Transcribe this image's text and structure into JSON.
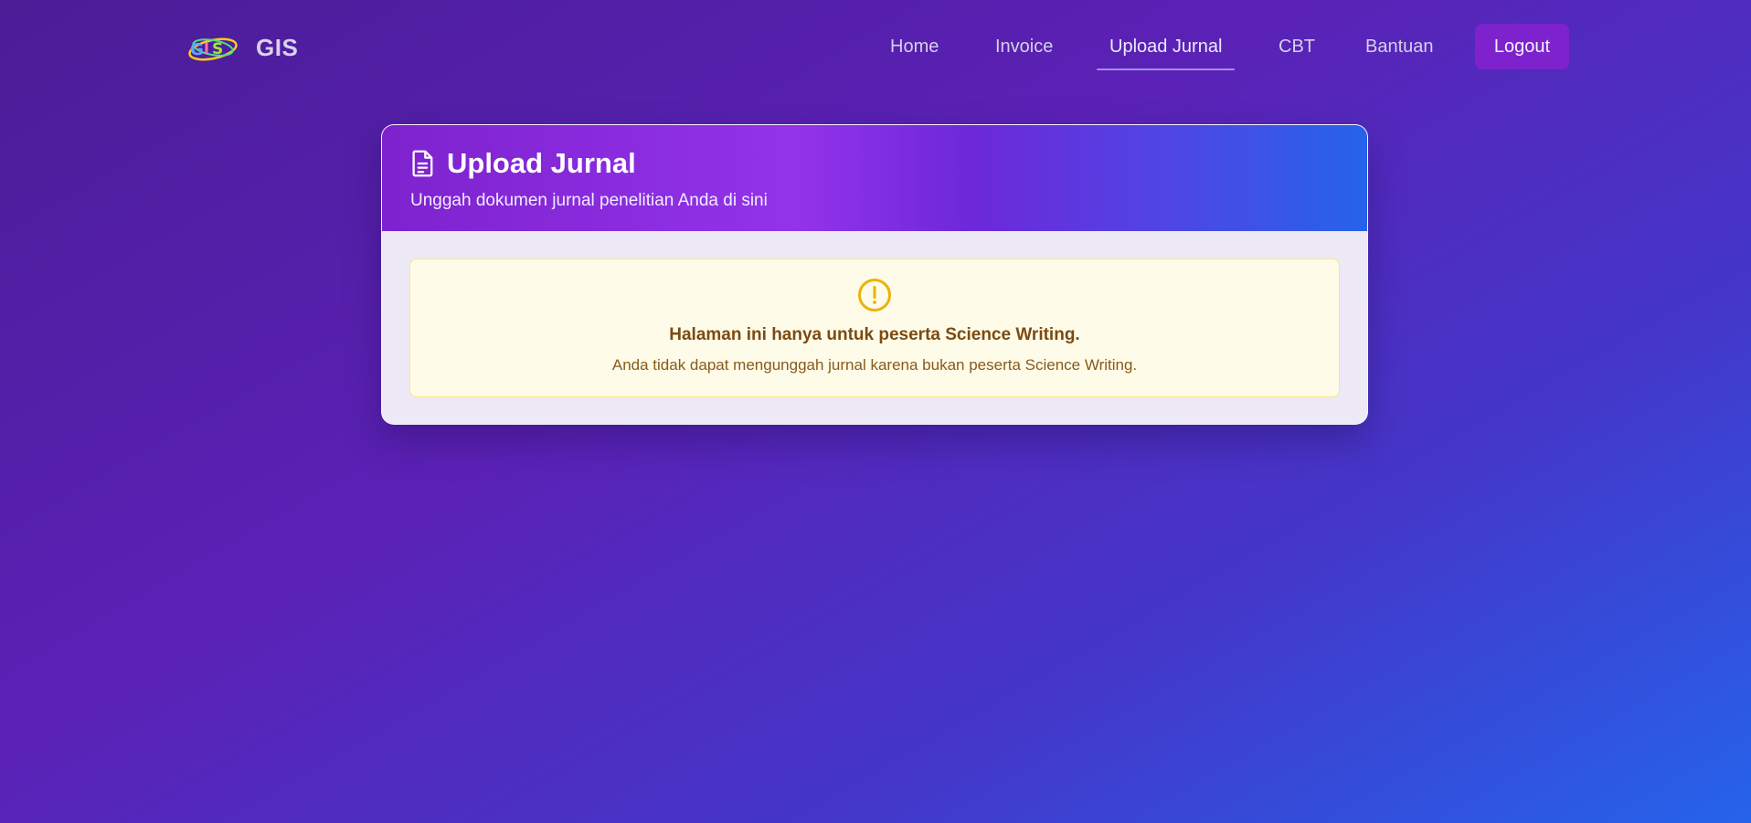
{
  "brand": {
    "logo_icon": "gis-logo-icon",
    "name": "GIS"
  },
  "nav": {
    "items": [
      {
        "label": "Home"
      },
      {
        "label": "Invoice"
      },
      {
        "label": "Upload Jurnal",
        "active": true
      },
      {
        "label": "CBT"
      },
      {
        "label": "Bantuan"
      }
    ],
    "logout_label": "Logout"
  },
  "card": {
    "icon": "document-icon",
    "title": "Upload Jurnal",
    "subtitle": "Unggah dokumen jurnal penelitian Anda di sini"
  },
  "alert": {
    "icon": "exclamation-circle-icon",
    "title": "Halaman ini hanya untuk peserta Science Writing.",
    "message": "Anda tidak dapat mengunggah jurnal karena bukan peserta Science Writing."
  },
  "colors": {
    "accent": "#7e22ce",
    "warning_border": "#fde68a",
    "warning_bg": "#fefbe8",
    "warning_icon": "#eab308"
  }
}
